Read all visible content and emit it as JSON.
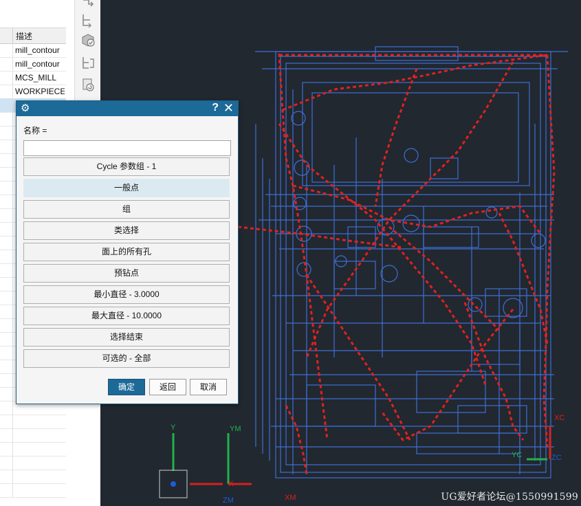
{
  "navigator": {
    "column_header": "描述",
    "rows": [
      {
        "desc": "mill_contour"
      },
      {
        "desc": "mill_contour"
      },
      {
        "desc": "MCS_MILL"
      },
      {
        "desc": "WORKPIECE"
      },
      {
        "desc": ""
      }
    ]
  },
  "dialog": {
    "help_label": "?",
    "close_label": "✕",
    "name_label": "名称   =",
    "name_value": "",
    "buttons": [
      "Cycle 参数组 - 1",
      "一般点",
      "组",
      "类选择",
      "面上的所有孔",
      "预钻点",
      "最小直径 - 3.0000",
      "最大直径 - 10.0000",
      "选择结束",
      "可选的 - 全部"
    ],
    "ok_label": "确定",
    "back_label": "返回",
    "cancel_label": "取消"
  },
  "viewport": {
    "axis_labels": {
      "ym": "YM",
      "xm": "XM",
      "zm": "ZM",
      "y": "Y",
      "x": "X",
      "xc": "XC",
      "yc": "YC",
      "zc": "ZC"
    },
    "watermark": "UG爱好者论坛@1550991599"
  },
  "colors": {
    "viewport_bg": "#212830",
    "geometry_blue": "#3f6fd6",
    "toolpath_red": "#e0221e",
    "dialog_title": "#1c6a98",
    "annotation_red": "#e0161a"
  }
}
